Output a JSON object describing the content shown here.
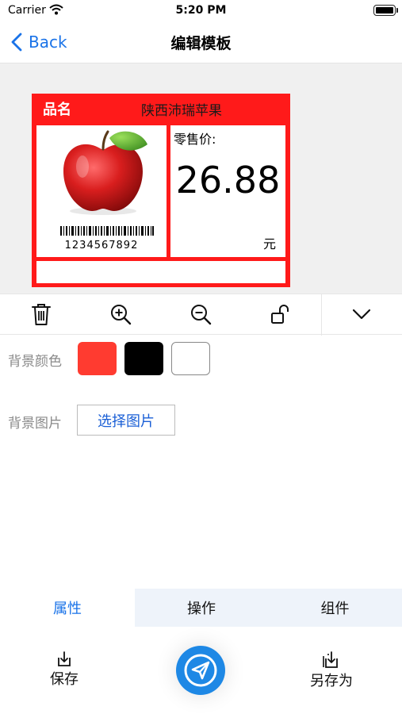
{
  "status_bar": {
    "carrier": "Carrier",
    "time": "5:20 PM"
  },
  "nav": {
    "back_label": "Back",
    "title": "编辑模板"
  },
  "label": {
    "title": "品名",
    "product_name": "陕西沛瑞苹果",
    "barcode_number": "1234567892",
    "price_label": "零售价:",
    "price": "26.88",
    "unit": "元",
    "colors": {
      "frame": "#ff1a1a",
      "background": "#ffffff"
    }
  },
  "toolbar": {
    "items": [
      {
        "icon": "trash-icon"
      },
      {
        "icon": "zoom-in-icon"
      },
      {
        "icon": "zoom-out-icon"
      },
      {
        "icon": "unlock-icon"
      },
      {
        "icon": "chevron-down-icon"
      }
    ]
  },
  "properties": {
    "background_color_label": "背景颜色",
    "swatches": [
      "#ff3b30",
      "#000000",
      "#ffffff"
    ],
    "background_image_label": "背景图片",
    "select_image_label": "选择图片"
  },
  "tabs": [
    {
      "label": "属性",
      "active": true
    },
    {
      "label": "操作",
      "active": false
    },
    {
      "label": "组件",
      "active": false
    }
  ],
  "actions": {
    "save_label": "保存",
    "save_as_label": "另存为",
    "send_icon": "send-icon"
  },
  "accent_color": "#1a73e8"
}
